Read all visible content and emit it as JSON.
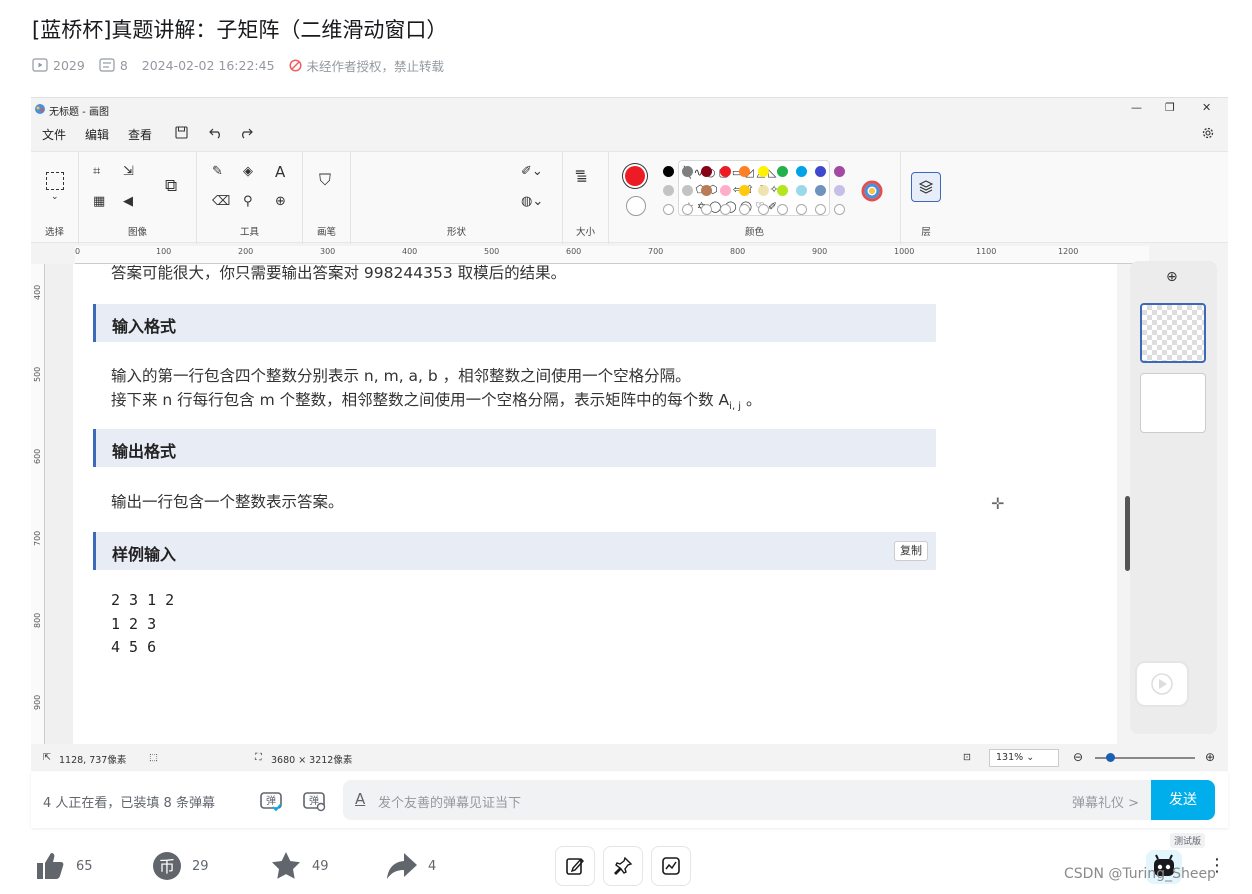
{
  "page": {
    "title": "[蓝桥杯]真题讲解：子矩阵（二维滑动窗口）",
    "meta": {
      "plays": "2029",
      "danmaku_count": "8",
      "date": "2024-02-02 16:22:45",
      "notice": "未经作者授权，禁止转载"
    }
  },
  "paint": {
    "window_title": "无标题 - 画图",
    "menu": [
      "文件",
      "编辑",
      "查看"
    ],
    "ribbon_groups": [
      "选择",
      "图像",
      "工具",
      "画笔",
      "形状",
      "大小",
      "颜色",
      "层"
    ],
    "ruler_labels": [
      "0",
      "100",
      "200",
      "300",
      "400",
      "500",
      "600",
      "700",
      "800",
      "900",
      "1000",
      "1100",
      "1200"
    ],
    "vruler_labels": [
      "400",
      "500",
      "600",
      "700",
      "800",
      "900"
    ],
    "colors_row1": [
      "#000000",
      "#7f7f7f",
      "#880015",
      "#ed1c24",
      "#ff7f27",
      "#fff200",
      "#22b14c",
      "#00a2e8",
      "#3f48cc",
      "#a349a4"
    ],
    "colors_row2": [
      "#c3c3c3",
      "#c3c3c3",
      "#b97a57",
      "#ffaec9",
      "#ffc90e",
      "#efe4b0",
      "#b5e61d",
      "#99d9ea",
      "#7092be",
      "#c8bfe7"
    ],
    "primary_color": "#ed1c24",
    "status": {
      "cursor": "1128, 737像素",
      "size": "3680 × 3212像素",
      "zoom": "131%"
    }
  },
  "doc": {
    "top_line": "答案可能很大，你只需要输出答案对 998244353 取模后的结果。",
    "input_heading": "输入格式",
    "input_line1": "输入的第一行包含四个整数分别表示 n, m, a, b ，相邻整数之间使用一个空格分隔。",
    "input_line2": "接下来 n 行每行包含 m 个整数，相邻整数之间使用一个空格分隔，表示矩阵中的每个数 A",
    "input_line2_sub": "i, j",
    "input_line2_end": " 。",
    "output_heading": "输出格式",
    "output_line": "输出一行包含一个整数表示答案。",
    "sample_heading": "样例输入",
    "copy_label": "复制",
    "sample_lines": [
      "2 3 1 2",
      "1 2 3",
      "4 5 6"
    ]
  },
  "danmaku": {
    "viewer_text": "4 人正在看，已装填 8 条弹幕",
    "placeholder": "发个友善的弹幕见证当下",
    "etiquette": "弹幕礼仪 >",
    "send": "发送"
  },
  "actions": {
    "likes": "65",
    "coins": "29",
    "favorites": "49",
    "shares": "4"
  },
  "badge": "测试版",
  "watermark": "CSDN @Turing_Sheep"
}
